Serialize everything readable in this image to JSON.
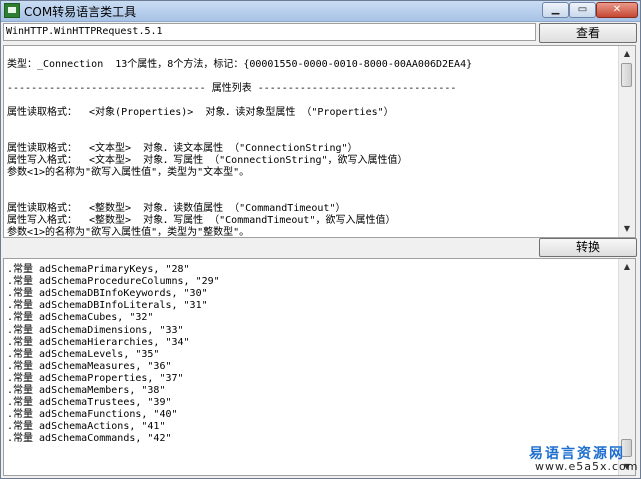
{
  "window": {
    "title": "COM转易语言类工具",
    "min_glyph": "▁",
    "max_glyph": "▭",
    "close_glyph": "✕"
  },
  "input": {
    "value": "WinHTTP.WinHTTPRequest.5.1"
  },
  "buttons": {
    "view_label": "查看",
    "convert_label": "转换"
  },
  "upper_text": {
    "lines": [
      "类型：_Connection  13个属性，8个方法，标记：{00001550-0000-0010-8000-00AA006D2EA4}",
      "",
      "--------------------------------- 属性列表 ---------------------------------",
      "",
      "属性读取格式：  <对象(Properties)>  对象．读对象型属性 （\"Properties\"）",
      "",
      "",
      "属性读取格式：  <文本型>  对象．读文本属性 （\"ConnectionString\"）",
      "属性写入格式：  <文本型>  对象．写属性 （\"ConnectionString\"，欲写入属性值）",
      "参数<1>的名称为\"欲写入属性值\"，类型为\"文本型\"。",
      "",
      "",
      "属性读取格式：  <整数型>  对象．读数值属性 （\"CommandTimeout\"）",
      "属性写入格式：  <整数型>  对象．写属性 （\"CommandTimeout\"，欲写入属性值）",
      "参数<1>的名称为\"欲写入属性值\"，类型为\"整数型\"。"
    ]
  },
  "lower_text": {
    "lines": [
      ".常量 adSchemaPrimaryKeys, \"28\"",
      ".常量 adSchemaProcedureColumns, \"29\"",
      ".常量 adSchemaDBInfoKeywords, \"30\"",
      ".常量 adSchemaDBInfoLiterals, \"31\"",
      ".常量 adSchemaCubes, \"32\"",
      ".常量 adSchemaDimensions, \"33\"",
      ".常量 adSchemaHierarchies, \"34\"",
      ".常量 adSchemaLevels, \"35\"",
      ".常量 adSchemaMeasures, \"36\"",
      ".常量 adSchemaProperties, \"37\"",
      ".常量 adSchemaMembers, \"38\"",
      ".常量 adSchemaTrustees, \"39\"",
      ".常量 adSchemaFunctions, \"40\"",
      ".常量 adSchemaActions, \"41\"",
      ".常量 adSchemaCommands, \"42\""
    ]
  },
  "scroll_arrows": {
    "up": "▲",
    "down": "▼"
  },
  "watermark": {
    "top": "易语言资源网",
    "bottom": "www.e5a5x.com"
  }
}
